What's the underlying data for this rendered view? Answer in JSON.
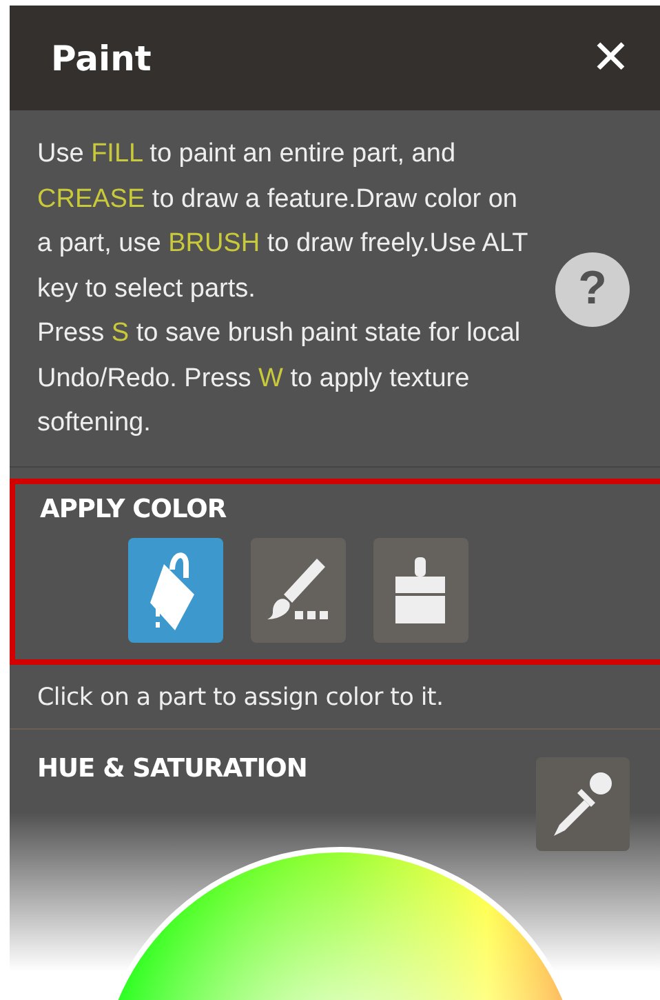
{
  "window": {
    "title": "Paint",
    "close": "✕"
  },
  "instructions": [
    {
      "text": "Use ",
      "key": false
    },
    {
      "text": "FILL",
      "key": true
    },
    {
      "text": " to paint an entire part, and ",
      "key": false
    },
    {
      "text": "CREASE",
      "key": true
    },
    {
      "text": " to draw a feature.Draw color on a part, use ",
      "key": false
    },
    {
      "text": "BRUSH",
      "key": true
    },
    {
      "text": " to draw freely.Use ALT key to select parts.\nPress ",
      "key": false
    },
    {
      "text": "S",
      "key": true
    },
    {
      "text": " to save brush paint state for local Undo/Redo. Press ",
      "key": false
    },
    {
      "text": "W",
      "key": true
    },
    {
      "text": " to apply texture softening.",
      "key": false
    }
  ],
  "help": "?",
  "apply_color": {
    "title": "APPLY COLOR",
    "highlighted": true,
    "tools": [
      {
        "kind": "fill",
        "selected": true
      },
      {
        "kind": "crease",
        "selected": false
      },
      {
        "kind": "brush",
        "selected": false
      }
    ]
  },
  "hint": "Click on a part to assign color to it.",
  "hue_saturation": {
    "title": "HUE & SATURATION"
  }
}
